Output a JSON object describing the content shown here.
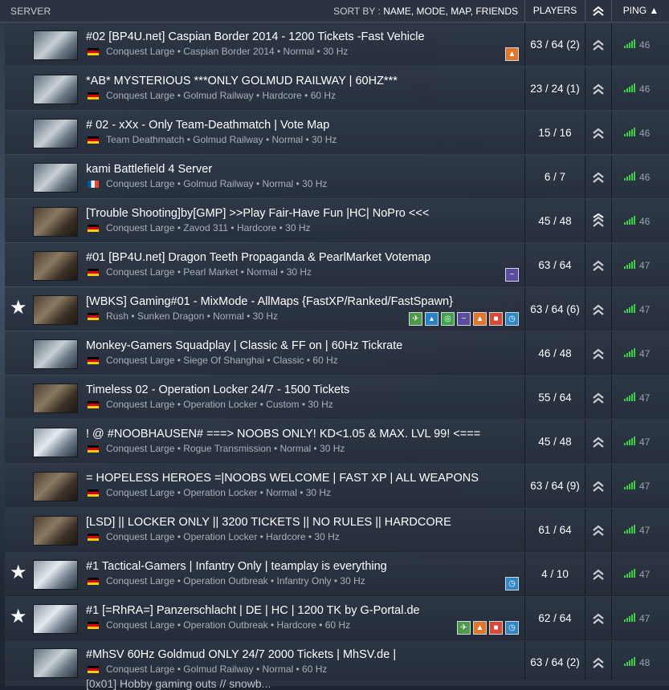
{
  "header": {
    "server": "SERVER",
    "sort_by": "SORT BY :",
    "sort_options": "NAME, MODE, MAP, FRIENDS",
    "players": "PLAYERS",
    "ping": "PING ▲"
  },
  "rows": [
    {
      "fav": "",
      "name": "#02 [BP4U.net] Caspian Border 2014 - 1200 Tickets -Fast Vehicle",
      "flag": "de",
      "mode": "Conquest Large",
      "map": "Caspian Border 2014",
      "preset": "Normal",
      "tick": "30 Hz",
      "players": "63 / 64 (2)",
      "ping": "46",
      "badges": [
        "fire"
      ],
      "thumb": "light",
      "chev": "double"
    },
    {
      "fav": "",
      "name": "*AB* MYSTERIOUS ***ONLY GOLMUD RAILWAY | 60HZ***",
      "flag": "de",
      "mode": "Conquest Large",
      "map": "Golmud Railway",
      "preset": "Hardcore",
      "tick": "60 Hz",
      "players": "23 / 24 (1)",
      "ping": "46",
      "badges": [],
      "thumb": "light",
      "chev": "double"
    },
    {
      "fav": "",
      "name": "# 02 - xXx - Only Team-Deathmatch | Vote Map",
      "flag": "de",
      "mode": "Team Deathmatch",
      "map": "Golmud Railway",
      "preset": "Normal",
      "tick": "30 Hz",
      "players": "15 / 16",
      "ping": "46",
      "badges": [],
      "thumb": "light",
      "chev": "double"
    },
    {
      "fav": "",
      "name": "kami Battlefield 4 Server",
      "flag": "fr",
      "mode": "Conquest Large",
      "map": "Golmud Railway",
      "preset": "Normal",
      "tick": "30 Hz",
      "players": "6 / 7",
      "ping": "46",
      "badges": [],
      "thumb": "light",
      "chev": "double"
    },
    {
      "fav": "",
      "name": "[Trouble Shooting]by[GMP] >>Play Fair-Have Fun |HC| NoPro <<<",
      "flag": "de",
      "mode": "Conquest Large",
      "map": "Zavod 311",
      "preset": "Hardcore",
      "tick": "30 Hz",
      "players": "45 / 48",
      "ping": "46",
      "badges": [],
      "thumb": "dark",
      "chev": "triple"
    },
    {
      "fav": "",
      "name": "#01 [BP4U.net] Dragon Teeth Propaganda & PearlMarket Votemap",
      "flag": "de",
      "mode": "Conquest Large",
      "map": "Pearl Market",
      "preset": "Normal",
      "tick": "30 Hz",
      "players": "63 / 64",
      "ping": "47",
      "badges": [
        "wave"
      ],
      "thumb": "dark",
      "chev": "double"
    },
    {
      "fav": "★",
      "name": "[WBKS] Gaming#01 - MixMode - AllMaps {FastXP/Ranked/FastSpawn}",
      "flag": "de",
      "mode": "Rush",
      "map": "Sunken Dragon",
      "preset": "Normal",
      "tick": "30 Hz",
      "players": "63 / 64 (6)",
      "ping": "47",
      "badges": [
        "plane",
        "ship",
        "ring",
        "wave",
        "fire",
        "red",
        "time"
      ],
      "thumb": "dark",
      "chev": "double"
    },
    {
      "fav": "",
      "name": "Monkey-Gamers Squadplay | Classic & FF on | 60Hz Tickrate",
      "flag": "de",
      "mode": "Conquest Large",
      "map": "Siege Of Shanghai",
      "preset": "Classic",
      "tick": "60 Hz",
      "players": "46 / 48",
      "ping": "47",
      "badges": [],
      "thumb": "light",
      "chev": "double"
    },
    {
      "fav": "",
      "name": "Timeless 02 - Operation Locker 24/7 - 1500 Tickets",
      "flag": "de",
      "mode": "Conquest Large",
      "map": "Operation Locker",
      "preset": "Custom",
      "tick": "30 Hz",
      "players": "55 / 64",
      "ping": "47",
      "badges": [],
      "thumb": "dark",
      "chev": "double"
    },
    {
      "fav": "",
      "name": "! @ #NOOBHAUSEN# ===> NOOBS ONLY! KD<1.05 & MAX. LVL 99! <===",
      "flag": "de",
      "mode": "Conquest Large",
      "map": "Rogue Transmission",
      "preset": "Normal",
      "tick": "30 Hz",
      "players": "45 / 48",
      "ping": "47",
      "badges": [],
      "thumb": "snow",
      "chev": "double"
    },
    {
      "fav": "",
      "name": "= HOPELESS HEROES =|NOOBS WELCOME | FAST XP | ALL WEAPONS",
      "flag": "de",
      "mode": "Conquest Large",
      "map": "Operation Locker",
      "preset": "Normal",
      "tick": "30 Hz",
      "players": "63 / 64 (9)",
      "ping": "47",
      "badges": [],
      "thumb": "dark",
      "chev": "double"
    },
    {
      "fav": "",
      "name": "[LSD] || LOCKER ONLY || 3200 TICKETS || NO RULES || HARDCORE",
      "flag": "de",
      "mode": "Conquest Large",
      "map": "Operation Locker",
      "preset": "Hardcore",
      "tick": "30 Hz",
      "players": "61 / 64",
      "ping": "47",
      "badges": [],
      "thumb": "dark",
      "chev": "double"
    },
    {
      "fav": "★",
      "name": "#1 Tactical-Gamers | Infantry Only | teamplay is everything",
      "flag": "de",
      "mode": "Conquest Large",
      "map": "Operation Outbreak",
      "preset": "Infantry Only",
      "tick": "30 Hz",
      "players": "4 / 10",
      "ping": "47",
      "badges": [
        "time"
      ],
      "thumb": "snow",
      "chev": "double"
    },
    {
      "fav": "★",
      "name": "#1 [=RhRA=] Panzerschlacht | DE | HC | 1200 TK by G-Portal.de",
      "flag": "de",
      "mode": "Conquest Large",
      "map": "Operation Outbreak",
      "preset": "Hardcore",
      "tick": "60 Hz",
      "players": "62 / 64",
      "ping": "47",
      "badges": [
        "plane",
        "fire",
        "red",
        "time"
      ],
      "thumb": "snow",
      "chev": "double"
    },
    {
      "fav": "",
      "name": "#MhSV 60Hz Goldmud ONLY 24/7 2000 Tickets | MhSV.de |",
      "flag": "de",
      "mode": "Conquest Large",
      "map": "Golmud Railway",
      "preset": "Normal",
      "tick": "60 Hz",
      "players": "63 / 64 (2)",
      "ping": "48",
      "badges": [],
      "thumb": "light",
      "chev": "double"
    }
  ],
  "partial_row": "[0x01] Hobby gaming outs // snowb..."
}
